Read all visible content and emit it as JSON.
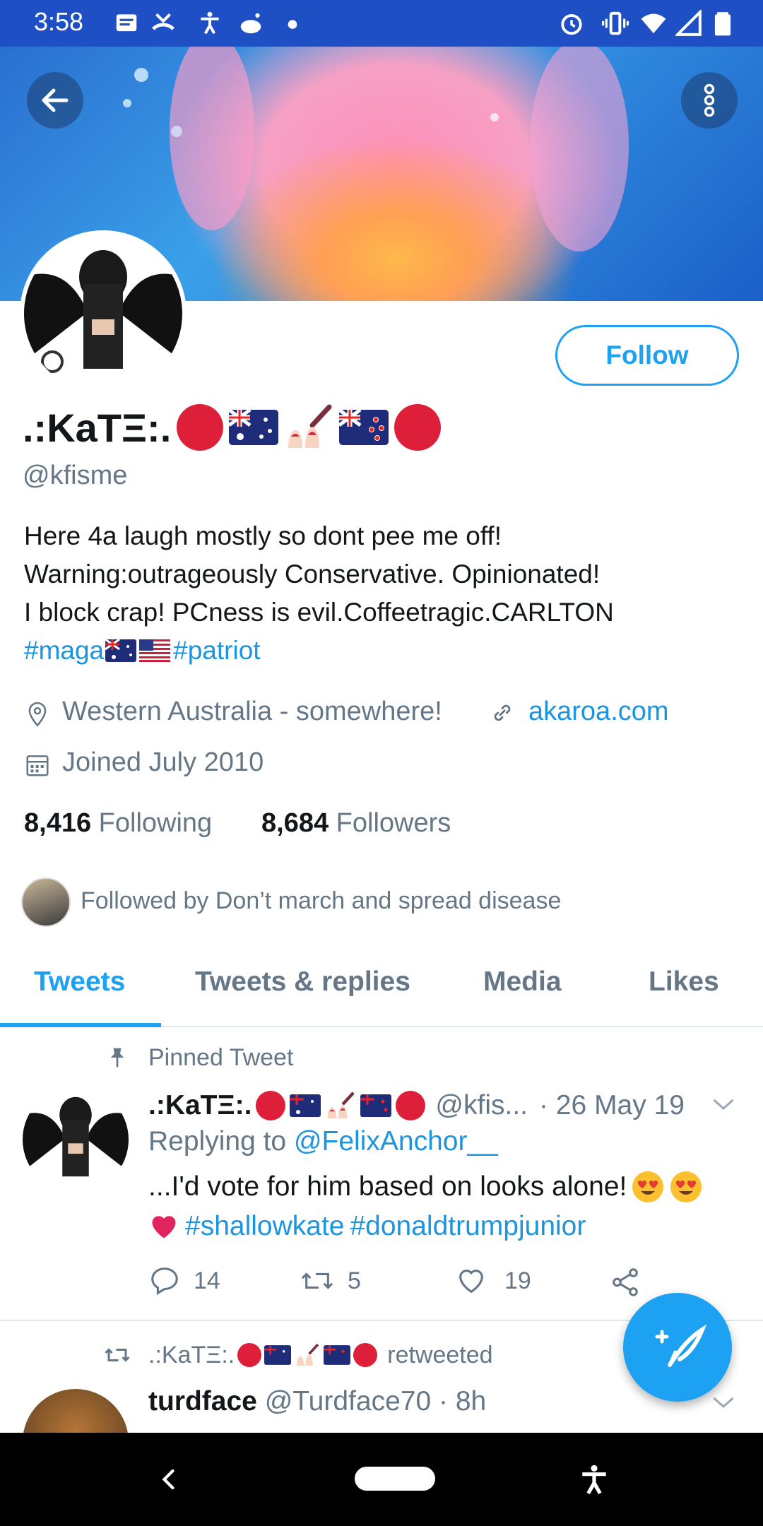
{
  "status_bar": {
    "time": "3:58"
  },
  "profile": {
    "display_name": ".:KaTΞ:.",
    "handle": "@kfisme",
    "follow_label": "Follow",
    "bio_lines": [
      "Here 4a laugh mostly so dont pee me off!",
      "Warning:outrageously Conservative. Opinionated!",
      "I block crap! PCness is evil.Coffeetragic.CARLTON"
    ],
    "hashtag_1": "#maga",
    "hashtag_2": "#patriot",
    "location": "Western Australia - somewhere!",
    "website": "akaroa.com",
    "joined": "Joined July 2010",
    "following_count": "8,416",
    "following_label": "Following",
    "followers_count": "8,684",
    "followers_label": "Followers",
    "followed_by": "Followed by Don’t march and spread disease"
  },
  "tabs": [
    {
      "label": "Tweets",
      "active": true
    },
    {
      "label": "Tweets & replies"
    },
    {
      "label": "Media"
    },
    {
      "label": "Likes"
    }
  ],
  "pinned_tweet": {
    "pinned_label": "Pinned Tweet",
    "name": ".:KaTΞ:.",
    "handle": "@kfis...",
    "date": "· 26 May 19",
    "replying_prefix": "Replying to ",
    "replying_to": "@FelixAnchor__",
    "text": "...I'd vote for him based on looks alone!",
    "hashtag_1": "#shallowkate",
    "hashtag_2": "#donaldtrumpjunior",
    "replies": "14",
    "retweets": "5",
    "likes": "19"
  },
  "retweet": {
    "retweeter": ".:KaTΞ:.",
    "retweeted_label": "retweeted",
    "name": "turdface",
    "handle": "@Turdface70",
    "time": "· 8h"
  },
  "colors": {
    "accent": "#1da1f2",
    "status_bar": "#1f4fc4",
    "red_circle": "#dd1f3a"
  }
}
